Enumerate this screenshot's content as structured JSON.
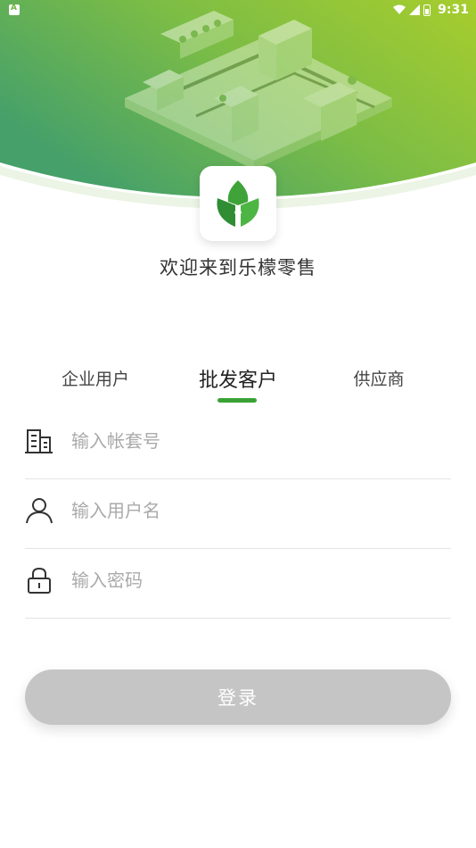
{
  "status_bar": {
    "time": "9:31"
  },
  "app": {
    "welcome_text": "欢迎来到乐檬零售"
  },
  "tabs": [
    {
      "label": "企业用户",
      "active": false
    },
    {
      "label": "批发客户",
      "active": true
    },
    {
      "label": "供应商",
      "active": false
    }
  ],
  "form": {
    "account_placeholder": "输入帐套号",
    "username_placeholder": "输入用户名",
    "password_placeholder": "输入密码",
    "login_label": "登录"
  },
  "colors": {
    "brand_green": "#3aa235",
    "header_gradient_start": "#4aa36a",
    "header_gradient_end": "#9dc832",
    "button_disabled": "#c5c5c5"
  }
}
